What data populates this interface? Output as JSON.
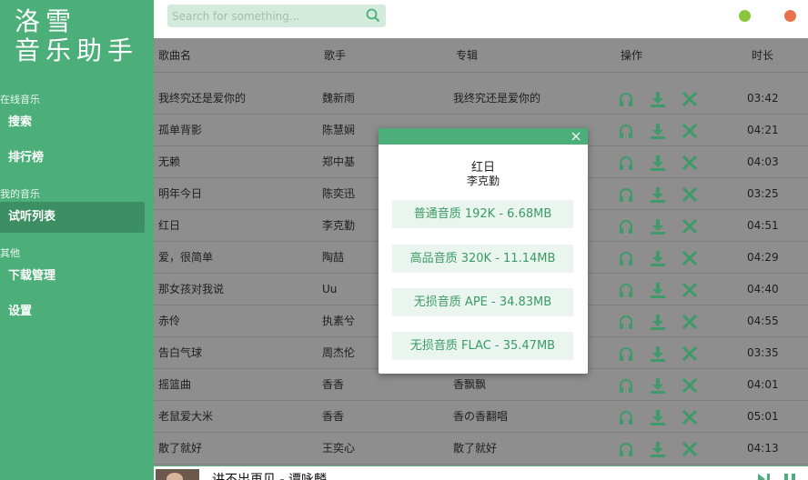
{
  "app": {
    "logo_line1": "洛雪",
    "logo_line2": "音乐助手"
  },
  "sidebar": {
    "sections": [
      {
        "title": "在线音乐",
        "items": [
          "搜索",
          "排行榜"
        ]
      },
      {
        "title": "我的音乐",
        "items": [
          "试听列表"
        ]
      },
      {
        "title": "其他",
        "items": [
          "下载管理",
          "设置"
        ]
      }
    ],
    "active_item": "试听列表"
  },
  "search": {
    "placeholder": "Search for something..."
  },
  "table": {
    "headers": [
      "歌曲名",
      "歌手",
      "专辑",
      "操作",
      "时长"
    ],
    "rows": [
      {
        "title": "我终究还是爱你的",
        "artist": "魏新雨",
        "album": "我终究还是爱你的",
        "duration": "03:42"
      },
      {
        "title": "孤单背影",
        "artist": "陈慧娴",
        "album": "",
        "duration": "04:21"
      },
      {
        "title": "无赖",
        "artist": "郑中基",
        "album": "",
        "duration": "04:03"
      },
      {
        "title": "明年今日",
        "artist": "陈奕迅",
        "album": "",
        "duration": "03:25"
      },
      {
        "title": "红日",
        "artist": "李克勤",
        "album": "",
        "duration": "04:51"
      },
      {
        "title": "爱，很简单",
        "artist": "陶喆",
        "album": "",
        "duration": "04:29"
      },
      {
        "title": "那女孩对我说",
        "artist": "Uu",
        "album": "",
        "duration": "04:40"
      },
      {
        "title": "赤伶",
        "artist": "执素兮",
        "album": "",
        "duration": "04:55"
      },
      {
        "title": "告白气球",
        "artist": "周杰伦",
        "album": "",
        "duration": "03:35"
      },
      {
        "title": "摇篮曲",
        "artist": "香香",
        "album": "香飘飘",
        "duration": "04:01"
      },
      {
        "title": "老鼠爱大米",
        "artist": "香香",
        "album": "香の香翻唱",
        "duration": "05:01"
      },
      {
        "title": "散了就好",
        "artist": "王奕心",
        "album": "散了就好",
        "duration": "04:13"
      }
    ]
  },
  "modal": {
    "song": "红日",
    "artist": "李克勤",
    "options": [
      "普通音质 192K - 6.68MB",
      "高品音质 320K - 11.14MB",
      "无损音质 APE - 34.83MB",
      "无损音质 FLAC - 35.47MB"
    ]
  },
  "player": {
    "now_playing": "讲不出再见 - 谭咏麟"
  },
  "icons": {
    "listen": "headphones-icon",
    "download": "download-icon",
    "delete": "close-x-icon",
    "search": "search-icon"
  },
  "colors": {
    "accent": "#4caf7a",
    "accent_dark": "#3c8f63",
    "overlay_gray": "#8e8e8e",
    "minimize_dot": "#8cc63f",
    "close_dot": "#e8724b"
  }
}
